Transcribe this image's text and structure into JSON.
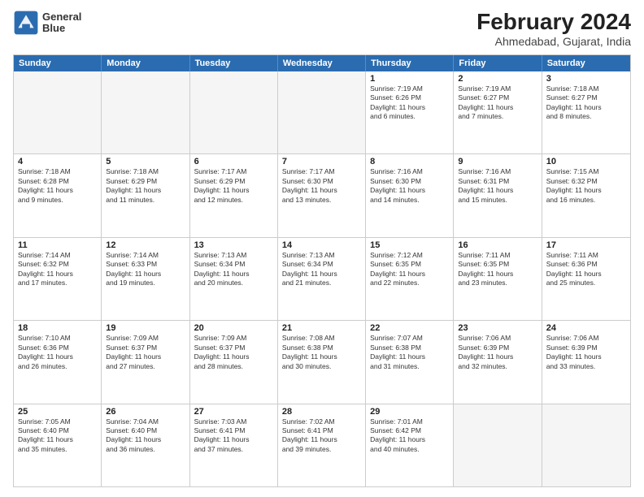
{
  "logo": {
    "line1": "General",
    "line2": "Blue"
  },
  "title": "February 2024",
  "subtitle": "Ahmedabad, Gujarat, India",
  "header": {
    "days": [
      "Sunday",
      "Monday",
      "Tuesday",
      "Wednesday",
      "Thursday",
      "Friday",
      "Saturday"
    ]
  },
  "weeks": [
    [
      {
        "num": "",
        "info": "",
        "empty": true
      },
      {
        "num": "",
        "info": "",
        "empty": true
      },
      {
        "num": "",
        "info": "",
        "empty": true
      },
      {
        "num": "",
        "info": "",
        "empty": true
      },
      {
        "num": "1",
        "info": "Sunrise: 7:19 AM\nSunset: 6:26 PM\nDaylight: 11 hours\nand 6 minutes.",
        "empty": false
      },
      {
        "num": "2",
        "info": "Sunrise: 7:19 AM\nSunset: 6:27 PM\nDaylight: 11 hours\nand 7 minutes.",
        "empty": false
      },
      {
        "num": "3",
        "info": "Sunrise: 7:18 AM\nSunset: 6:27 PM\nDaylight: 11 hours\nand 8 minutes.",
        "empty": false
      }
    ],
    [
      {
        "num": "4",
        "info": "Sunrise: 7:18 AM\nSunset: 6:28 PM\nDaylight: 11 hours\nand 9 minutes.",
        "empty": false
      },
      {
        "num": "5",
        "info": "Sunrise: 7:18 AM\nSunset: 6:29 PM\nDaylight: 11 hours\nand 11 minutes.",
        "empty": false
      },
      {
        "num": "6",
        "info": "Sunrise: 7:17 AM\nSunset: 6:29 PM\nDaylight: 11 hours\nand 12 minutes.",
        "empty": false
      },
      {
        "num": "7",
        "info": "Sunrise: 7:17 AM\nSunset: 6:30 PM\nDaylight: 11 hours\nand 13 minutes.",
        "empty": false
      },
      {
        "num": "8",
        "info": "Sunrise: 7:16 AM\nSunset: 6:30 PM\nDaylight: 11 hours\nand 14 minutes.",
        "empty": false
      },
      {
        "num": "9",
        "info": "Sunrise: 7:16 AM\nSunset: 6:31 PM\nDaylight: 11 hours\nand 15 minutes.",
        "empty": false
      },
      {
        "num": "10",
        "info": "Sunrise: 7:15 AM\nSunset: 6:32 PM\nDaylight: 11 hours\nand 16 minutes.",
        "empty": false
      }
    ],
    [
      {
        "num": "11",
        "info": "Sunrise: 7:14 AM\nSunset: 6:32 PM\nDaylight: 11 hours\nand 17 minutes.",
        "empty": false
      },
      {
        "num": "12",
        "info": "Sunrise: 7:14 AM\nSunset: 6:33 PM\nDaylight: 11 hours\nand 19 minutes.",
        "empty": false
      },
      {
        "num": "13",
        "info": "Sunrise: 7:13 AM\nSunset: 6:34 PM\nDaylight: 11 hours\nand 20 minutes.",
        "empty": false
      },
      {
        "num": "14",
        "info": "Sunrise: 7:13 AM\nSunset: 6:34 PM\nDaylight: 11 hours\nand 21 minutes.",
        "empty": false
      },
      {
        "num": "15",
        "info": "Sunrise: 7:12 AM\nSunset: 6:35 PM\nDaylight: 11 hours\nand 22 minutes.",
        "empty": false
      },
      {
        "num": "16",
        "info": "Sunrise: 7:11 AM\nSunset: 6:35 PM\nDaylight: 11 hours\nand 23 minutes.",
        "empty": false
      },
      {
        "num": "17",
        "info": "Sunrise: 7:11 AM\nSunset: 6:36 PM\nDaylight: 11 hours\nand 25 minutes.",
        "empty": false
      }
    ],
    [
      {
        "num": "18",
        "info": "Sunrise: 7:10 AM\nSunset: 6:36 PM\nDaylight: 11 hours\nand 26 minutes.",
        "empty": false
      },
      {
        "num": "19",
        "info": "Sunrise: 7:09 AM\nSunset: 6:37 PM\nDaylight: 11 hours\nand 27 minutes.",
        "empty": false
      },
      {
        "num": "20",
        "info": "Sunrise: 7:09 AM\nSunset: 6:37 PM\nDaylight: 11 hours\nand 28 minutes.",
        "empty": false
      },
      {
        "num": "21",
        "info": "Sunrise: 7:08 AM\nSunset: 6:38 PM\nDaylight: 11 hours\nand 30 minutes.",
        "empty": false
      },
      {
        "num": "22",
        "info": "Sunrise: 7:07 AM\nSunset: 6:38 PM\nDaylight: 11 hours\nand 31 minutes.",
        "empty": false
      },
      {
        "num": "23",
        "info": "Sunrise: 7:06 AM\nSunset: 6:39 PM\nDaylight: 11 hours\nand 32 minutes.",
        "empty": false
      },
      {
        "num": "24",
        "info": "Sunrise: 7:06 AM\nSunset: 6:39 PM\nDaylight: 11 hours\nand 33 minutes.",
        "empty": false
      }
    ],
    [
      {
        "num": "25",
        "info": "Sunrise: 7:05 AM\nSunset: 6:40 PM\nDaylight: 11 hours\nand 35 minutes.",
        "empty": false
      },
      {
        "num": "26",
        "info": "Sunrise: 7:04 AM\nSunset: 6:40 PM\nDaylight: 11 hours\nand 36 minutes.",
        "empty": false
      },
      {
        "num": "27",
        "info": "Sunrise: 7:03 AM\nSunset: 6:41 PM\nDaylight: 11 hours\nand 37 minutes.",
        "empty": false
      },
      {
        "num": "28",
        "info": "Sunrise: 7:02 AM\nSunset: 6:41 PM\nDaylight: 11 hours\nand 39 minutes.",
        "empty": false
      },
      {
        "num": "29",
        "info": "Sunrise: 7:01 AM\nSunset: 6:42 PM\nDaylight: 11 hours\nand 40 minutes.",
        "empty": false
      },
      {
        "num": "",
        "info": "",
        "empty": true
      },
      {
        "num": "",
        "info": "",
        "empty": true
      }
    ]
  ]
}
